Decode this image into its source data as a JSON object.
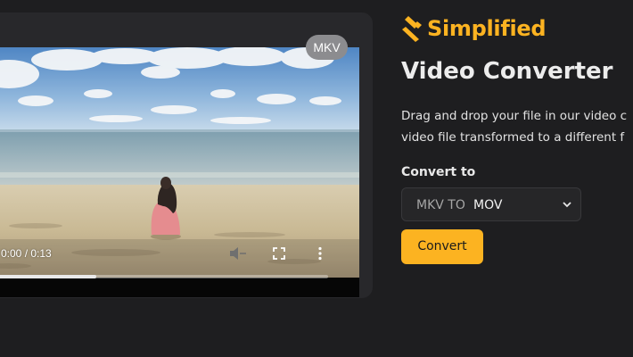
{
  "video": {
    "format_badge": "MKV",
    "time_display": "0:00 / 0:13",
    "progress_fraction": 0.33,
    "icons": {
      "play": "play-icon",
      "mute": "volume-muted-icon",
      "fullscreen": "fullscreen-icon",
      "more": "more-vertical-icon"
    }
  },
  "brand": {
    "name": "Simplified",
    "icon": "simplified-logo-icon",
    "color": "#fcb321"
  },
  "title": "Video Converter",
  "description_lines": [
    "Drag and drop your file in our video c",
    "video file transformed to a different f"
  ],
  "convert": {
    "label": "Convert to",
    "from_format": "MKV TO",
    "to_format": "MOV",
    "dropdown_icon": "chevron-down-icon",
    "button_label": "Convert"
  },
  "colors": {
    "accent": "#fcb321",
    "background": "#1e1e20",
    "card": "#28282b"
  }
}
